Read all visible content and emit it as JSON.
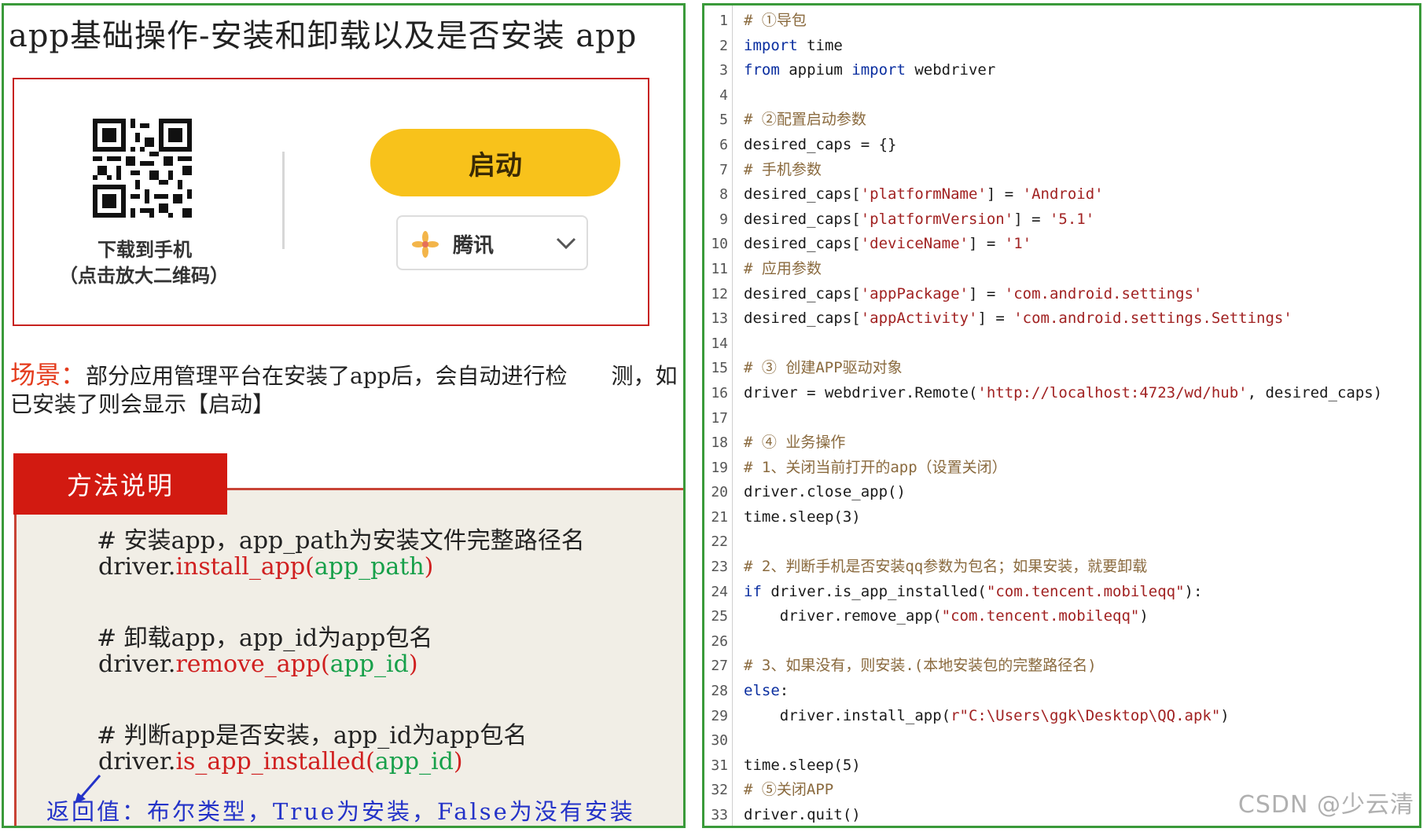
{
  "slide": {
    "title": "app基础操作-安装和卸载以及是否安装  app",
    "card": {
      "download_label": "下载到手机",
      "qr_hint": "（点击放大二维码）",
      "launch_button": "启动",
      "source_select": "腾讯"
    },
    "scene": {
      "label": "场景：",
      "text": "部分应用管理平台在安装了app后，会自动进行检　　测，如已安装了则会显示【启动】"
    },
    "method": {
      "tab_label": "方法说明",
      "items": [
        {
          "comment": "# 安装app，app_path为安装文件完整路径名",
          "obj": "driver.",
          "fn": "install_app(",
          "arg": "app_path",
          "close": ")"
        },
        {
          "comment": "# 卸载app，app_id为app包名",
          "obj": "driver.",
          "fn": "remove_app(",
          "arg": "app_id",
          "close": ")"
        },
        {
          "comment": "# 判断app是否安装，app_id为app包名",
          "obj": "driver.",
          "fn": "is_app_installed(",
          "arg": "app_id",
          "close": ")"
        }
      ],
      "return_note": "返回值：布尔类型，True为安装，False为没有安装"
    }
  },
  "code_editor": {
    "lines": [
      {
        "n": "1",
        "kind": "comment",
        "text": "# ①导包"
      },
      {
        "n": "2",
        "kind": "keyword",
        "kw": "import",
        "rest": " time"
      },
      {
        "n": "3",
        "kind": "plain",
        "html": "<span class=\"kw\">from</span> appium <span class=\"kw\">import</span> webdriver",
        "text": "from appium import webdriver"
      },
      {
        "n": "4",
        "kind": "plain",
        "text": ""
      },
      {
        "n": "5",
        "kind": "comment",
        "text": "# ②配置启动参数"
      },
      {
        "n": "6",
        "kind": "plain",
        "text": "desired_caps = {}"
      },
      {
        "n": "7",
        "kind": "comment",
        "text": "# 手机参数"
      },
      {
        "n": "8",
        "kind": "caps",
        "key": "'platformName'",
        "val": "'Android'"
      },
      {
        "n": "9",
        "kind": "caps",
        "key": "'platformVersion'",
        "val": "'5.1'"
      },
      {
        "n": "10",
        "kind": "caps",
        "key": "'deviceName'",
        "val": "'1'"
      },
      {
        "n": "11",
        "kind": "comment",
        "text": "# 应用参数"
      },
      {
        "n": "12",
        "kind": "caps",
        "key": "'appPackage'",
        "val": "'com.android.settings'"
      },
      {
        "n": "13",
        "kind": "caps",
        "key": "'appActivity'",
        "val": "'com.android.settings.Settings'"
      },
      {
        "n": "14",
        "kind": "plain",
        "text": ""
      },
      {
        "n": "15",
        "kind": "comment",
        "text": "# ③ 创建APP驱动对象"
      },
      {
        "n": "16",
        "kind": "remote",
        "pre": "driver = webdriver.Remote(",
        "str": "'http://localhost:4723/wd/hub'",
        "post": ", desired_caps)"
      },
      {
        "n": "17",
        "kind": "plain",
        "text": ""
      },
      {
        "n": "18",
        "kind": "comment",
        "text": "# ④ 业务操作"
      },
      {
        "n": "19",
        "kind": "comment",
        "text": "# 1、关闭当前打开的app（设置关闭）"
      },
      {
        "n": "20",
        "kind": "plain",
        "text": "driver.close_app()"
      },
      {
        "n": "21",
        "kind": "plain",
        "text": "time.sleep(3)"
      },
      {
        "n": "22",
        "kind": "plain",
        "text": ""
      },
      {
        "n": "23",
        "kind": "comment",
        "text": "# 2、判断手机是否安装qq参数为包名；如果安装，就要卸载"
      },
      {
        "n": "24",
        "kind": "ifline",
        "kw": "if",
        "pre": " driver.is_app_installed(",
        "str": "\"com.tencent.mobileqq\"",
        "post": "):"
      },
      {
        "n": "25",
        "kind": "strcall",
        "pre": "    driver.remove_app(",
        "str": "\"com.tencent.mobileqq\"",
        "post": ")"
      },
      {
        "n": "26",
        "kind": "plain",
        "text": ""
      },
      {
        "n": "27",
        "kind": "comment",
        "text": "# 3、如果没有，则安装.(本地安装包的完整路径名)"
      },
      {
        "n": "28",
        "kind": "keyword",
        "kw": "else",
        "rest": ":"
      },
      {
        "n": "29",
        "kind": "strcall",
        "pre": "    driver.install_app(",
        "str": "r\"C:\\Users\\ggk\\Desktop\\QQ.apk\"",
        "post": ")"
      },
      {
        "n": "30",
        "kind": "plain",
        "text": ""
      },
      {
        "n": "31",
        "kind": "plain",
        "text": "time.sleep(5)"
      },
      {
        "n": "32",
        "kind": "comment",
        "text": "# ⑤关闭APP"
      },
      {
        "n": "33",
        "kind": "plain",
        "text": "driver.quit()"
      }
    ]
  },
  "watermark": "CSDN @少云清"
}
